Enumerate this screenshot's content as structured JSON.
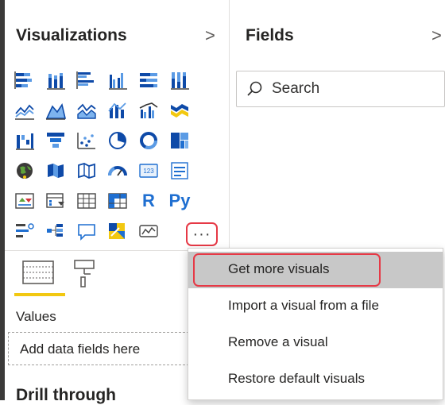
{
  "visualizations": {
    "title": "Visualizations",
    "expand_chevron": ">",
    "icons": [
      [
        "stacked-bar-chart-icon",
        "stacked-column-chart-icon",
        "clustered-bar-chart-icon",
        "clustered-column-chart-icon",
        "100-stacked-bar-chart-icon",
        "100-stacked-column-chart-icon"
      ],
      [
        "line-chart-icon",
        "area-chart-icon",
        "stacked-area-chart-icon",
        "line-and-stacked-column-icon",
        "line-and-clustered-column-icon",
        "ribbon-chart-icon"
      ],
      [
        "waterfall-chart-icon",
        "funnel-chart-icon",
        "scatter-chart-icon",
        "pie-chart-icon",
        "donut-chart-icon",
        "treemap-icon"
      ],
      [
        "map-icon",
        "filled-map-icon",
        "shape-map-icon",
        "gauge-icon",
        "card-icon",
        "multi-row-card-icon"
      ],
      [
        "kpi-icon",
        "slicer-icon",
        "table-icon",
        "matrix-icon",
        "r-script-visual-icon",
        "python-visual-icon"
      ],
      [
        "key-influencers-icon",
        "decomposition-tree-icon",
        "qa-visual-icon",
        "smart-narrative-icon",
        "paginated-report-icon"
      ]
    ],
    "r_label": "R",
    "py_label": "Py",
    "more_label": "···",
    "values_label": "Values",
    "drop_placeholder": "Add data fields here",
    "drill_title": "Drill through"
  },
  "fields": {
    "title": "Fields",
    "expand_chevron": ">",
    "search_placeholder": "Search"
  },
  "context_menu": {
    "items": [
      {
        "label": "Get more visuals",
        "highlighted": true
      },
      {
        "label": "Import a visual from a file",
        "highlighted": false
      },
      {
        "label": "Remove a visual",
        "highlighted": false
      },
      {
        "label": "Restore default visuals",
        "highlighted": false
      }
    ]
  },
  "colors": {
    "accent_blue": "#1f6fd1",
    "highlight_red": "#e63946",
    "tab_underline_yellow": "#f2c811",
    "menu_hover_gray": "#c8c8c8"
  }
}
